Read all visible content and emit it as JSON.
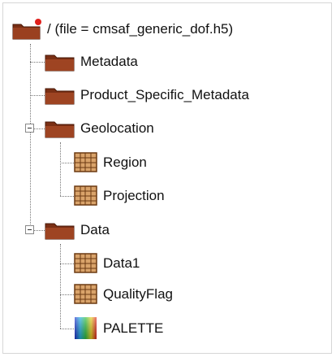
{
  "tree": {
    "root": {
      "label": "/ (file = cmsaf_generic_dof.h5)",
      "icon": "root-folder-icon"
    },
    "metadata": {
      "label": "Metadata",
      "icon": "folder-icon"
    },
    "product_specific_metadata": {
      "label": "Product_Specific_Metadata",
      "icon": "folder-icon"
    },
    "geolocation": {
      "label": "Geolocation",
      "icon": "folder-icon",
      "expanded": true,
      "children": [
        {
          "label": "Region",
          "icon": "dataset-icon"
        },
        {
          "label": "Projection",
          "icon": "dataset-icon"
        }
      ]
    },
    "data": {
      "label": "Data",
      "icon": "folder-icon",
      "expanded": true,
      "children": [
        {
          "label": "Data1",
          "icon": "dataset-icon"
        },
        {
          "label": "QualityFlag",
          "icon": "dataset-icon"
        },
        {
          "label": "PALETTE",
          "icon": "palette-image-icon"
        }
      ]
    }
  },
  "colors": {
    "folder": "#8b3a1a",
    "folder_dark": "#5a2410",
    "dataset": "#c98a4b",
    "root_marker": "#e0201c"
  }
}
